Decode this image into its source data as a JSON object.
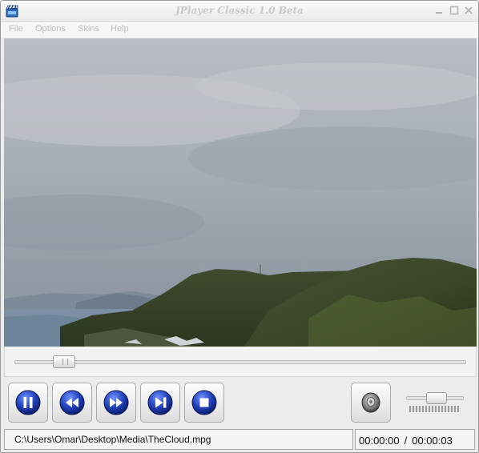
{
  "window": {
    "title": "JPlayer Classic 1.0 Beta",
    "app_icon": "film-clapper-icon",
    "controls": [
      "minimize-icon",
      "maximize-icon",
      "close-icon"
    ]
  },
  "menu": {
    "items": [
      {
        "label": "File"
      },
      {
        "label": "Options"
      },
      {
        "label": "Skins"
      },
      {
        "label": "Help"
      }
    ]
  },
  "video": {
    "content": "landscape-video-frame",
    "description_icon": "video-frame"
  },
  "seek": {
    "position_fraction": 0.09
  },
  "transport": {
    "buttons": [
      {
        "name": "pause-button",
        "icon": "pause-icon"
      },
      {
        "name": "rewind-button",
        "icon": "rewind-icon"
      },
      {
        "name": "fast-forward-button",
        "icon": "fast-forward-icon"
      },
      {
        "name": "next-track-button",
        "icon": "skip-next-icon"
      },
      {
        "name": "stop-button",
        "icon": "stop-icon"
      }
    ],
    "accent": "#1f3fb8"
  },
  "volume": {
    "icon": "speaker-icon",
    "level_fraction": 0.55
  },
  "status": {
    "file_path": "C:\\Users\\Omar\\Desktop\\Media\\TheCloud.mpg",
    "current_time": "00:00:00",
    "separator": "/",
    "total_time": "00:00:03"
  }
}
